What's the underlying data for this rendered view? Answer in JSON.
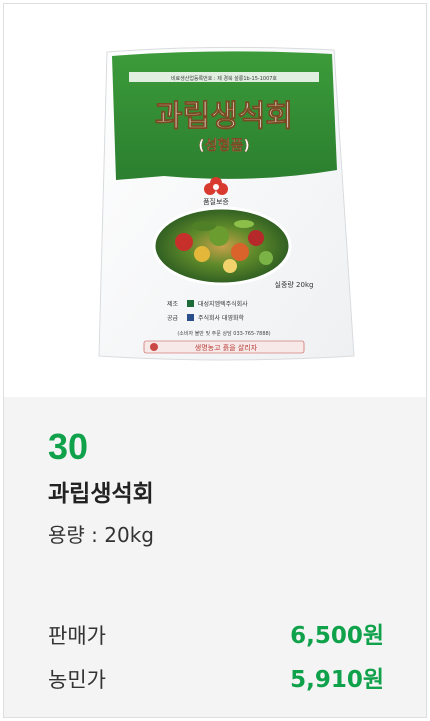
{
  "product": {
    "rank": "30",
    "name": "과립생석회",
    "capacity": "용량 : 20kg",
    "image": {
      "title": "과립생석회",
      "subtitle": "(성형품)",
      "top_small_text": "비료생산업등록번호 : 제 경북 설룡1b-15-1007호",
      "quality_badge": "품질보증",
      "weight_text": "실중량 20kg",
      "maker_label": "제조",
      "maker_value": "대성지엠텍주식회사",
      "supplier_label": "공급",
      "supplier_value": "주식회사 대영화학",
      "contact_line": "(소비자 불만 및 주문 상담 033-765-7888)",
      "bottom_slogan": "생명농고 흙을 살리자"
    }
  },
  "prices": [
    {
      "label": "판매가",
      "value": "6,500원"
    },
    {
      "label": "농민가",
      "value": "5,910원"
    }
  ],
  "colors": {
    "accent_green": "#10a14b",
    "bag_green": "#2f8f33",
    "info_bg": "#f4f4f4"
  }
}
